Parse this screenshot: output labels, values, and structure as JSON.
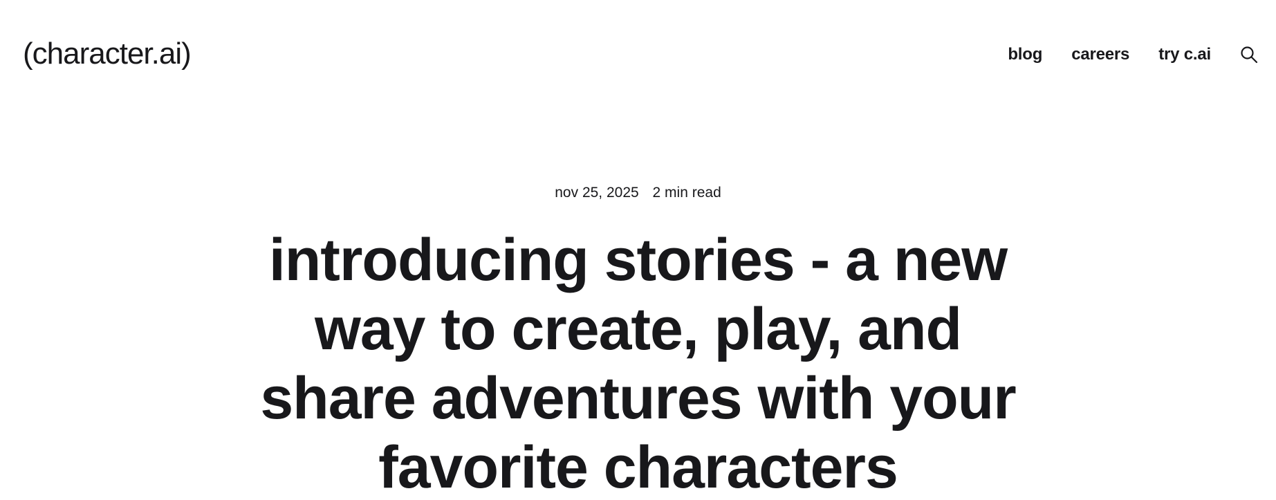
{
  "header": {
    "logo_text": "(character.ai)",
    "nav": {
      "blog_label": "blog",
      "careers_label": "careers",
      "try_label": "try c.ai"
    },
    "search_icon": "search-icon"
  },
  "article": {
    "date": "nov 25, 2025",
    "read_time": "2 min read",
    "title": "introducing stories - a new way to create, play, and share adventures with your favorite characters"
  },
  "colors": {
    "text": "#18181b",
    "background": "#ffffff"
  }
}
